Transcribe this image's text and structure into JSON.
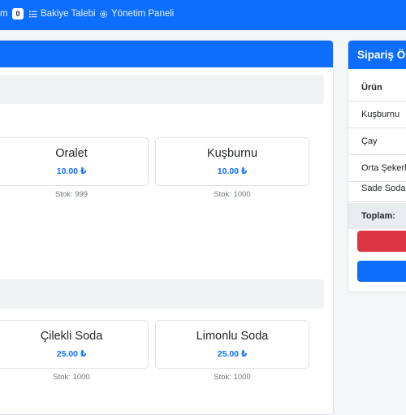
{
  "navbar": {
    "cut_item": "m",
    "cart_count": "0",
    "balance_request": "Bakiye Talebi",
    "admin_panel": "Yönetim Paneli",
    "icons": [
      "list-icon",
      "gear-icon"
    ]
  },
  "products": [
    {
      "name": "Oralet",
      "price": "10.00 ₺",
      "stock": "Stok: 999"
    },
    {
      "name": "Kuşburnu",
      "price": "10.00 ₺",
      "stock": "Stok: 1000"
    },
    {
      "name": "Çilekli Soda",
      "price": "25.00 ₺",
      "stock": "Stok: 1000"
    },
    {
      "name": "Limonlu Soda",
      "price": "25.00 ₺",
      "stock": "Stok: 1000"
    }
  ],
  "summary": {
    "title": "Sipariş Öz",
    "column_header": "Ürün",
    "items": [
      "Kuşburnu",
      "Çay",
      "Orta Şekerli",
      "Sade Soda"
    ],
    "total_label": "Toplam:"
  },
  "colors": {
    "primary": "#0d6efd",
    "danger": "#dc3545"
  }
}
